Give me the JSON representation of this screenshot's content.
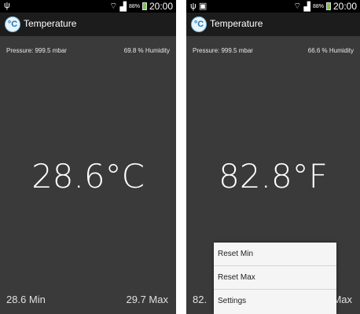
{
  "left_screen": {
    "status_time": "20:00",
    "status_battery": "88%",
    "app_title": "Temperature",
    "app_icon_text": "°C",
    "pressure": "Pressure: 999.5 mbar",
    "humidity": "69.8 % Humidity",
    "temperature": "28.6°C",
    "min": "28.6 Min",
    "max": "29.7 Max"
  },
  "right_screen": {
    "status_time": "20:00",
    "status_battery": "88%",
    "app_title": "Temperature",
    "app_icon_text": "°C",
    "pressure": "Pressure: 999.5 mbar",
    "humidity": "66.6 % Humidity",
    "temperature": "82.8°F",
    "min": "82.",
    "max": "Max",
    "menu": [
      "Reset Min",
      "Reset Max",
      "Settings"
    ]
  }
}
